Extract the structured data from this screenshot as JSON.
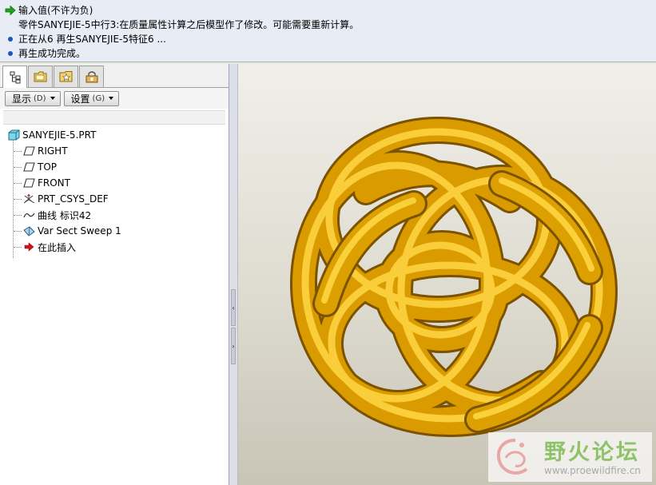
{
  "messages": [
    {
      "kind": "prompt",
      "icon": "green-arrow-icon",
      "text": "输入值(不许为负)"
    },
    {
      "kind": "info",
      "icon": "",
      "text": "零件SANYEJIE-5中行3:在质量属性计算之后模型作了修改。可能需要重新计算。"
    },
    {
      "kind": "bullet",
      "icon": "blue-dot-icon",
      "text": "正在从6 再生SANYEJIE-5特征6 ..."
    },
    {
      "kind": "bullet",
      "icon": "blue-dot-icon",
      "text": "再生成功完成。"
    }
  ],
  "tabs": [
    {
      "name": "model-tree-tab",
      "icon": "model-tree-icon"
    },
    {
      "name": "folder-browser-tab",
      "icon": "folder-icon"
    },
    {
      "name": "favorites-tab",
      "icon": "favorites-icon"
    },
    {
      "name": "connections-tab",
      "icon": "connections-icon"
    }
  ],
  "toolbar": {
    "show_label": "显示",
    "show_key": "(D)",
    "settings_label": "设置",
    "settings_key": "(G)"
  },
  "tree": {
    "root": "SANYEJIE-5.PRT",
    "items": [
      {
        "label": "RIGHT",
        "icon": "datum-plane-icon"
      },
      {
        "label": "TOP",
        "icon": "datum-plane-icon"
      },
      {
        "label": "FRONT",
        "icon": "datum-plane-icon"
      },
      {
        "label": "PRT_CSYS_DEF",
        "icon": "coordinate-system-icon"
      },
      {
        "label": "曲线 标识42",
        "icon": "curve-icon"
      },
      {
        "label": "Var Sect Sweep 1",
        "icon": "sweep-icon"
      },
      {
        "label": "在此插入",
        "icon": "insert-here-arrow-icon"
      }
    ]
  },
  "colors": {
    "model_gold": "#e0a500",
    "model_shadow": "#9a6a00",
    "model_highlight": "#ffd23a",
    "message_bg": "#e8ecf4",
    "bullet_blue": "#1b57b6",
    "insert_red": "#d0141a",
    "watermark_green": "#8fc26a"
  },
  "watermark": {
    "title": "野火论坛",
    "url": "www.proewildfire.cn"
  }
}
